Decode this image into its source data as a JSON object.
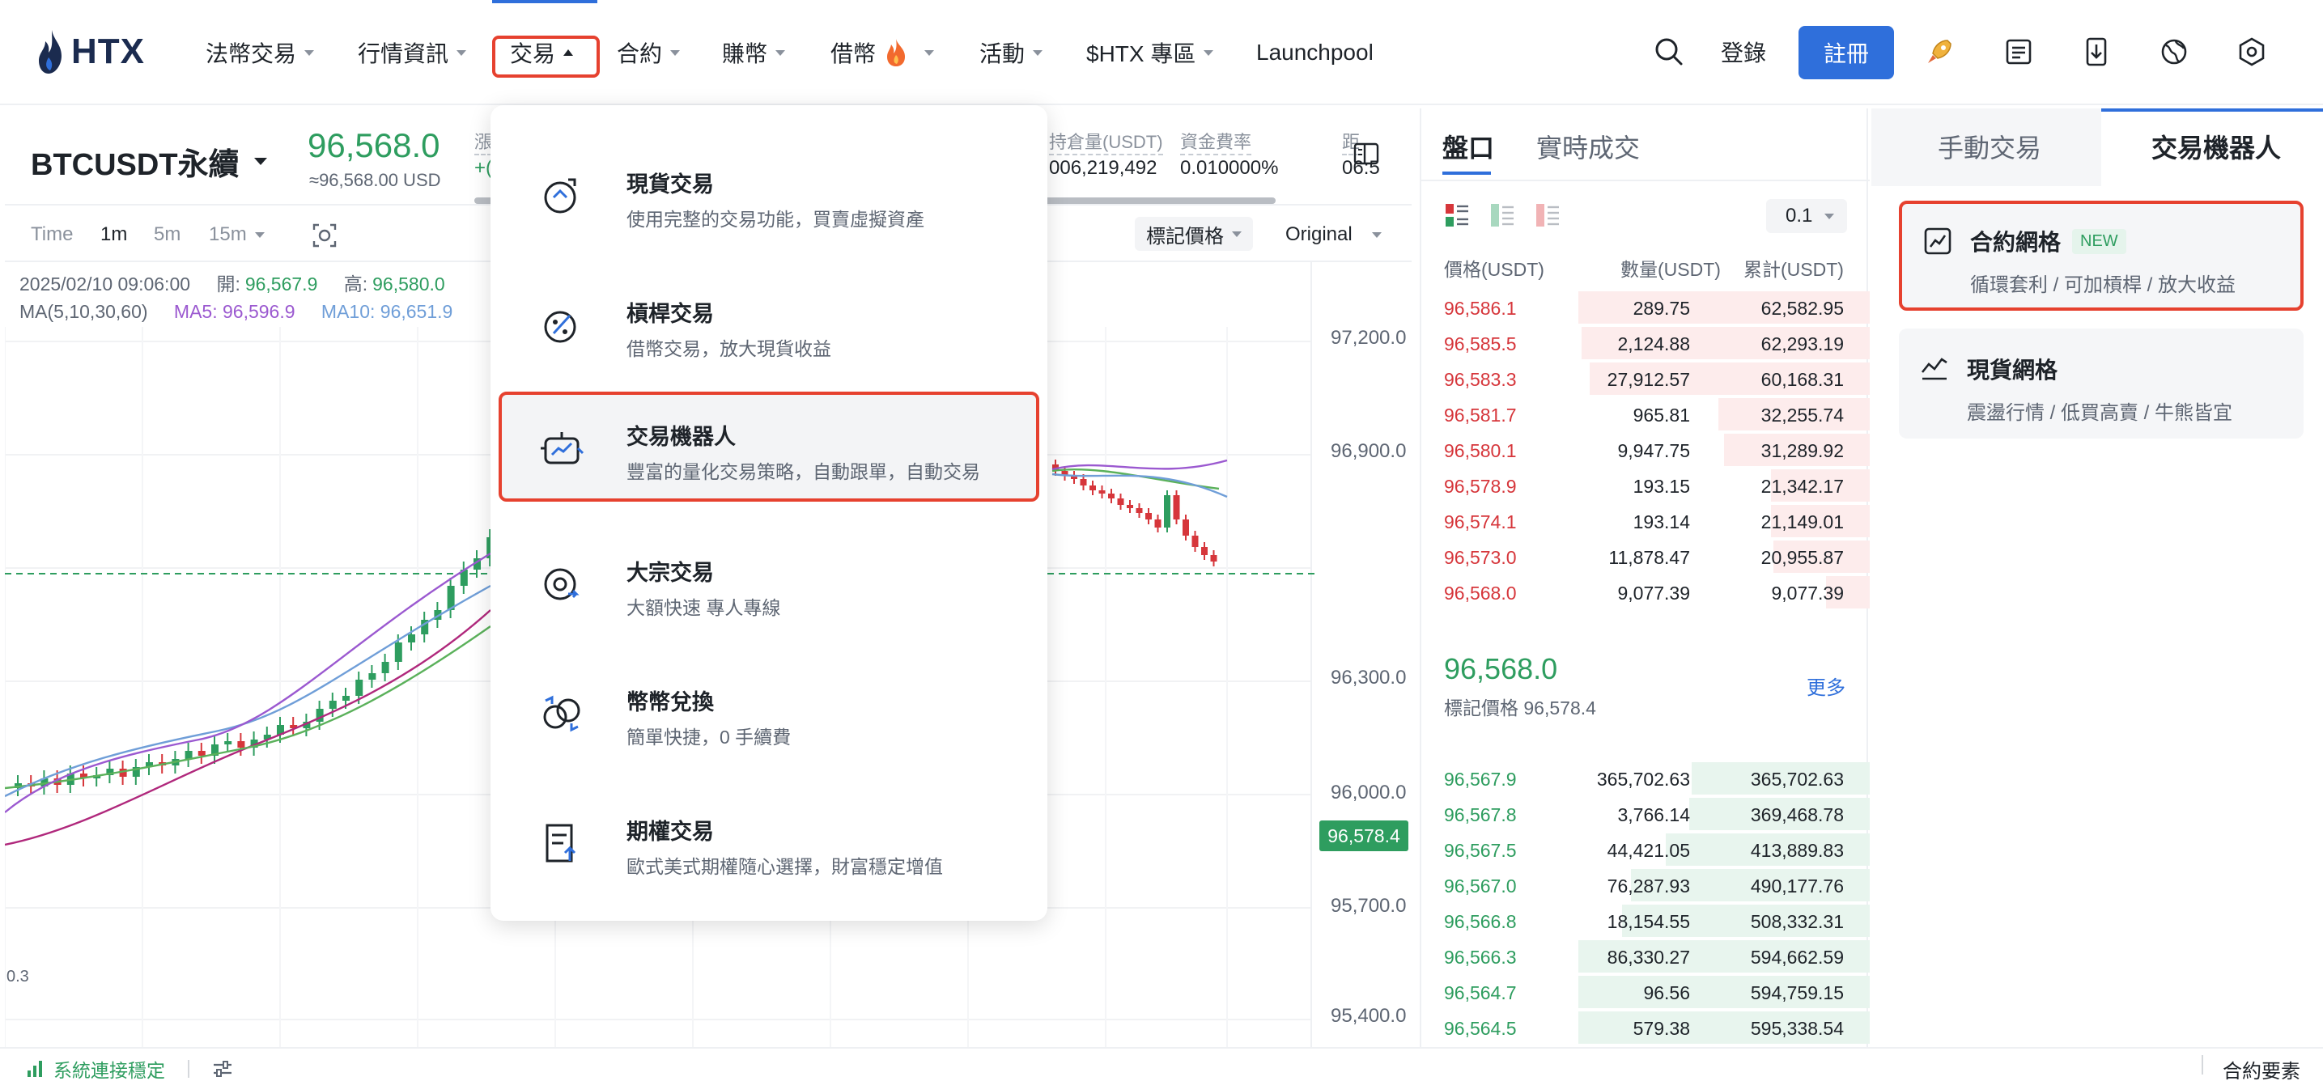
{
  "nav": {
    "logo": "HTX",
    "items": [
      {
        "label": "法幣交易",
        "caret": true
      },
      {
        "label": "行情資訊",
        "caret": true
      },
      {
        "label": "交易",
        "caret": true,
        "open": true
      },
      {
        "label": "合約",
        "caret": true
      },
      {
        "label": "賺幣",
        "caret": true
      },
      {
        "label": "借幣",
        "caret": true,
        "icon": "fire-icon"
      },
      {
        "label": "活動",
        "caret": true
      },
      {
        "label": "$HTX 專區",
        "caret": true
      },
      {
        "label": "Launchpool",
        "caret": false
      }
    ],
    "login": "登錄",
    "register": "註冊",
    "icons": [
      "search-icon",
      "rocket-icon",
      "orders-icon",
      "download-icon",
      "globe-icon",
      "settings-icon"
    ]
  },
  "ticker": {
    "symbol": "BTCUSDT永續",
    "last_price": "96,568.0",
    "last_price_usd": "≈96,568.00 USD",
    "change_label": "漲",
    "change_value": "+(",
    "open_interest_label": "持倉量(USDT)",
    "open_interest_value": "006,219,492",
    "funding_label": "資金費率",
    "funding_value": "0.010000%",
    "countdown_label": "距",
    "countdown_value": "06:5"
  },
  "chart_toolbar": {
    "timeframes": [
      "Time",
      "1m",
      "5m",
      "15m"
    ],
    "active": "1m",
    "mark_price_select": "標記價格",
    "view_select": "Original"
  },
  "chart_legend": {
    "datetime": "2025/02/10 09:06:00",
    "open_label": "開:",
    "open_value": "96,567.9",
    "high_label": "高:",
    "high_value": "96,580.0",
    "ma_label": "MA(5,10,30,60)",
    "ma5": "MA5: 96,596.9",
    "ma10": "MA10: 96,651.9",
    "left_edge_text": "0.3"
  },
  "chart_data": {
    "type": "line",
    "y_ticks": [
      "97,200.0",
      "96,900.0",
      "96,300.0",
      "96,000.0",
      "95,700.0",
      "95,400.0"
    ],
    "last_price_tag": "96,578.4",
    "colors": {
      "up": "#2e9d5f",
      "down": "#d6363b",
      "ma5": "#9b59d0",
      "ma10": "#6f9ed8",
      "ma30": "#5bb15b",
      "ma60": "#b0287c"
    }
  },
  "dropdown": {
    "items": [
      {
        "title": "現貨交易",
        "desc": "使用完整的交易功能，買賣虛擬資產",
        "icon": "spot-trade-icon"
      },
      {
        "title": "槓桿交易",
        "desc": "借幣交易，放大現貨收益",
        "icon": "margin-trade-icon"
      },
      {
        "title": "交易機器人",
        "desc": "豐富的量化交易策略，自動跟單，自動交易",
        "icon": "trading-bot-icon",
        "highlight": true
      },
      {
        "title": "大宗交易",
        "desc": "大額快速 專人專線",
        "icon": "block-trade-icon"
      },
      {
        "title": "幣幣兌換",
        "desc": "簡單快捷，0 手續費",
        "icon": "convert-icon"
      },
      {
        "title": "期權交易",
        "desc": "歐式美式期權隨心選擇，財富穩定增值",
        "icon": "options-icon"
      }
    ]
  },
  "orderbook": {
    "tabs": [
      "盤口",
      "實時成交"
    ],
    "step": "0.1",
    "headers": [
      "價格(USDT)",
      "數量(USDT)",
      "累計(USDT)"
    ],
    "asks": [
      {
        "p": "96,586.1",
        "q": "289.75",
        "t": "62,582.95",
        "w": 1.0
      },
      {
        "p": "96,585.5",
        "q": "2,124.88",
        "t": "62,293.19",
        "w": 0.99
      },
      {
        "p": "96,583.3",
        "q": "27,912.57",
        "t": "60,168.31",
        "w": 0.96
      },
      {
        "p": "96,581.7",
        "q": "965.81",
        "t": "32,255.74",
        "w": 0.52
      },
      {
        "p": "96,580.1",
        "q": "9,947.75",
        "t": "31,289.92",
        "w": 0.5
      },
      {
        "p": "96,578.9",
        "q": "193.15",
        "t": "21,342.17",
        "w": 0.34
      },
      {
        "p": "96,574.1",
        "q": "193.14",
        "t": "21,149.01",
        "w": 0.34
      },
      {
        "p": "96,573.0",
        "q": "11,878.47",
        "t": "20,955.87",
        "w": 0.33
      },
      {
        "p": "96,568.0",
        "q": "9,077.39",
        "t": "9,077.39",
        "w": 0.15
      }
    ],
    "mid_price": "96,568.0",
    "mark_label": "標記價格 96,578.4",
    "more": "更多",
    "bids": [
      {
        "p": "96,567.9",
        "q": "365,702.63",
        "t": "365,702.63",
        "w": 0.61
      },
      {
        "p": "96,567.8",
        "q": "3,766.14",
        "t": "369,468.78",
        "w": 0.62
      },
      {
        "p": "96,567.5",
        "q": "44,421.05",
        "t": "413,889.83",
        "w": 0.7
      },
      {
        "p": "96,567.0",
        "q": "76,287.93",
        "t": "490,177.76",
        "w": 0.82
      },
      {
        "p": "96,566.8",
        "q": "18,154.55",
        "t": "508,332.31",
        "w": 0.85
      },
      {
        "p": "96,566.3",
        "q": "86,330.27",
        "t": "594,662.59",
        "w": 1.0
      },
      {
        "p": "96,564.7",
        "q": "96.56",
        "t": "594,759.15",
        "w": 1.0
      },
      {
        "p": "96,564.5",
        "q": "579.38",
        "t": "595,338.54",
        "w": 1.0
      }
    ]
  },
  "right_panel": {
    "tabs": [
      "手動交易",
      "交易機器人"
    ],
    "cards": [
      {
        "title": "合約網格",
        "badge": "NEW",
        "desc": "循環套利 / 可加槓桿 / 放大收益",
        "highlight": true
      },
      {
        "title": "現貨網格",
        "badge": "",
        "desc": "震盪行情 / 低買高賣 / 牛熊皆宜",
        "highlight": false
      }
    ]
  },
  "footer": {
    "connection": "系統連接穩定",
    "right_label": "合約要素"
  }
}
